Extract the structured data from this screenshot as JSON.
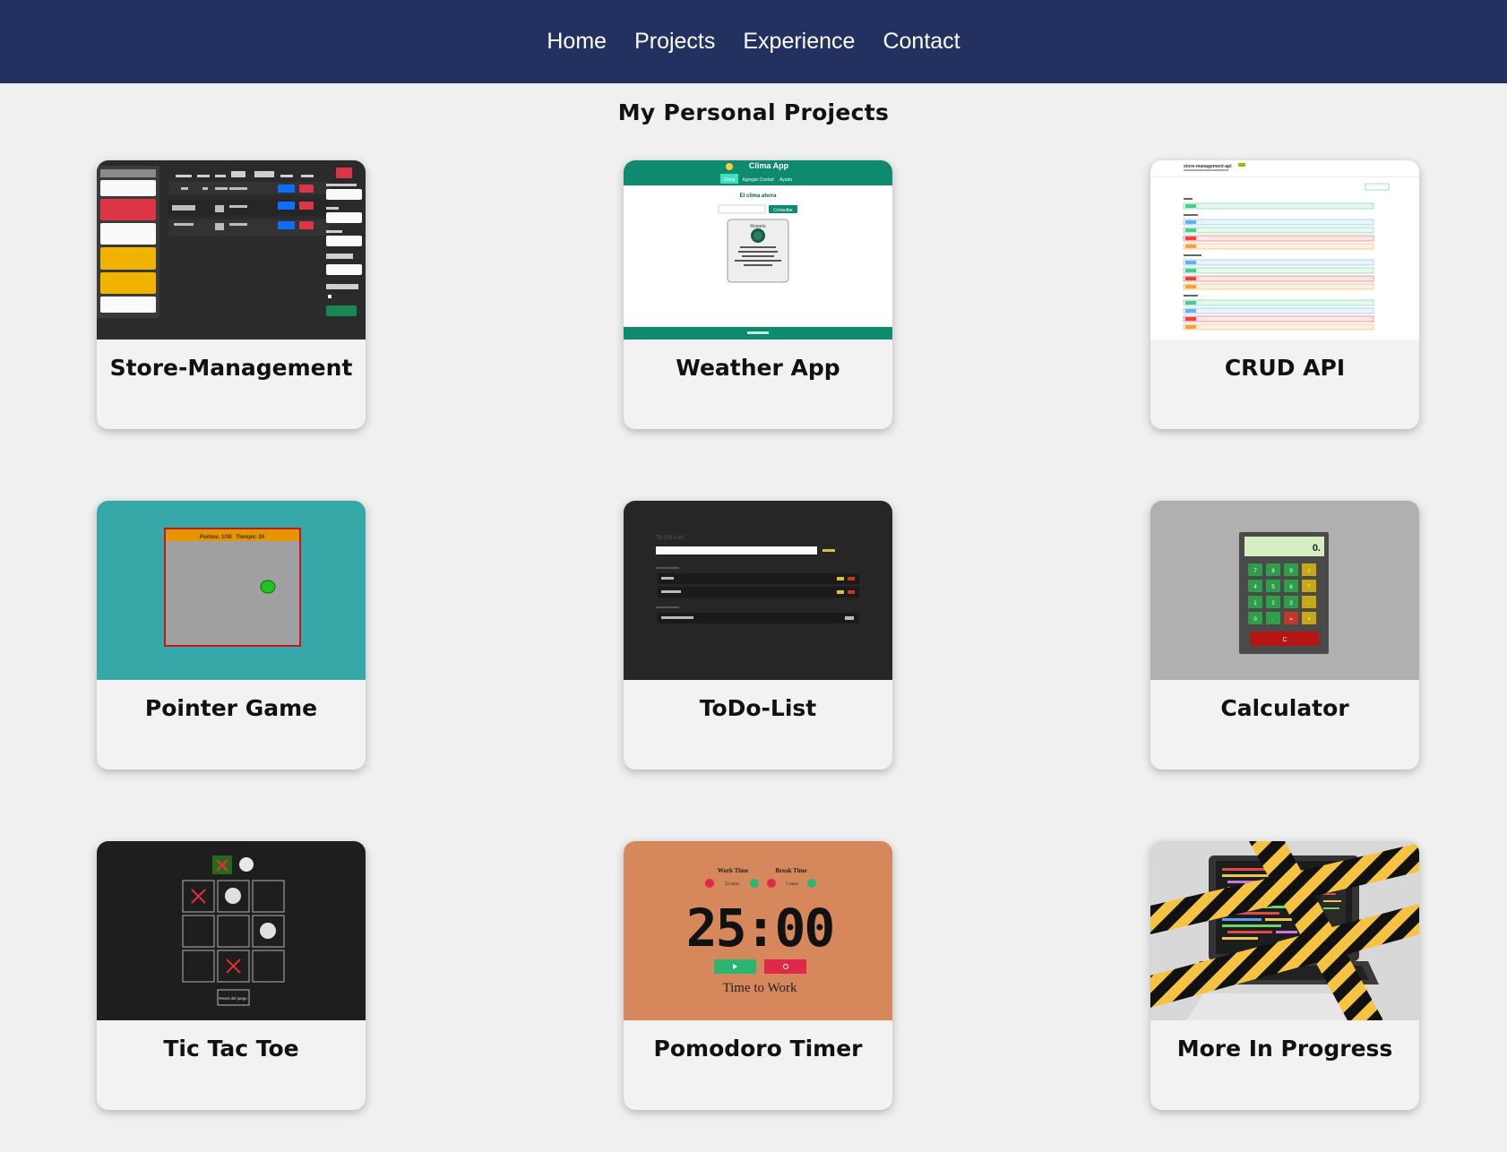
{
  "nav": {
    "items": [
      "Home",
      "Projects",
      "Experience",
      "Contact"
    ]
  },
  "page": {
    "title": "My Personal Projects"
  },
  "colors": {
    "nav_bg": "#223160",
    "page_bg": "#f0f0f0",
    "card_bg": "#f2f2f2"
  },
  "projects": [
    {
      "title": "Store-Management",
      "thumb_icon": "store-management-screenshot"
    },
    {
      "title": "Weather App",
      "thumb_icon": "weather-app-screenshot",
      "thumb": {
        "header": "Clima App",
        "tabs": [
          "Clima",
          "Agregar Ciudad",
          "Ayuda"
        ],
        "heading": "El clima ahora",
        "city": "Rosario",
        "button": "Consultar"
      }
    },
    {
      "title": "CRUD API",
      "thumb_icon": "crud-api-screenshot",
      "thumb": {
        "header": "store-management-api"
      }
    },
    {
      "title": "Pointer Game",
      "thumb_icon": "pointer-game-screenshot",
      "thumb": {
        "score": "Puntos: 1/30   Tiempo: 24"
      }
    },
    {
      "title": "ToDo-List",
      "thumb_icon": "todo-list-screenshot",
      "thumb": {
        "header": "To-Do List"
      }
    },
    {
      "title": "Calculator",
      "thumb_icon": "calculator-screenshot",
      "thumb": {
        "display": "0.",
        "keys": [
          "7",
          "8",
          "9",
          "/",
          "4",
          "5",
          "6",
          "*",
          "1",
          "2",
          "3",
          "-",
          "0",
          ".",
          "=",
          "+"
        ],
        "clear": "C"
      }
    },
    {
      "title": "Tic Tac Toe",
      "thumb_icon": "tic-tac-toe-screenshot",
      "thumb": {
        "reset": "Reset del juego"
      }
    },
    {
      "title": "Pomodoro Timer",
      "thumb_icon": "pomodoro-timer-screenshot",
      "thumb": {
        "work_label": "Work Time",
        "break_label": "Break Time",
        "work_mins": "25 mins",
        "break_mins": "5 mins",
        "clock": "25:00",
        "status": "Time to Work"
      }
    },
    {
      "title": "More In Progress",
      "thumb_icon": "under-construction-laptop-image"
    }
  ]
}
